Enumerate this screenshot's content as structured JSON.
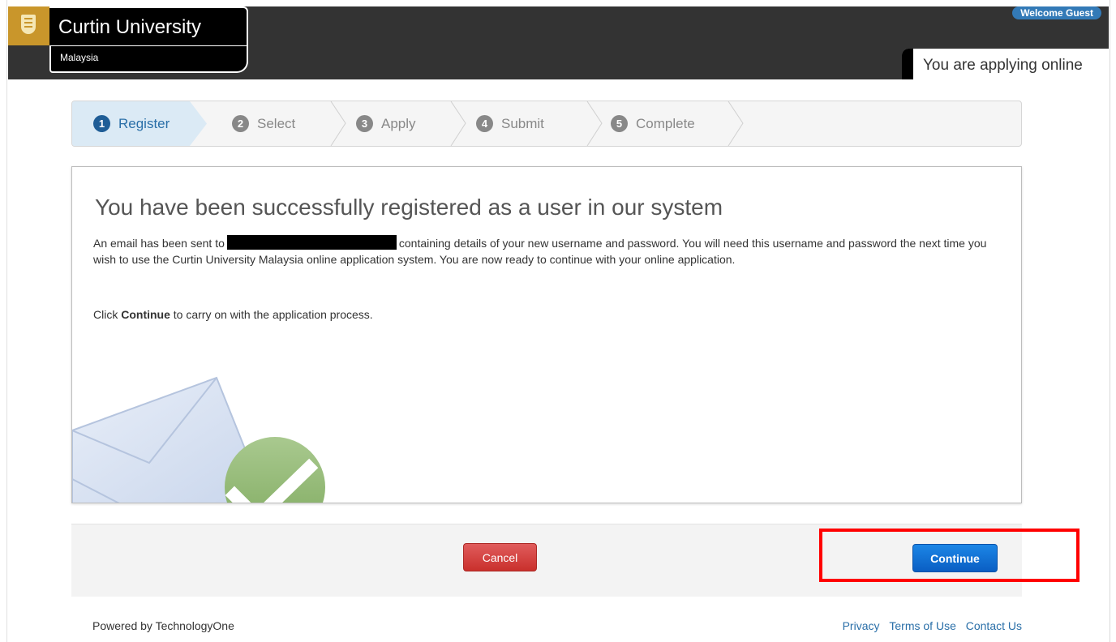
{
  "header": {
    "brand_name": "Curtin University",
    "brand_sub": "Malaysia",
    "welcome": "Welcome Guest",
    "applying": "You are applying online"
  },
  "wizard": {
    "steps": [
      {
        "num": "1",
        "label": "Register",
        "active": true
      },
      {
        "num": "2",
        "label": "Select",
        "active": false
      },
      {
        "num": "3",
        "label": "Apply",
        "active": false
      },
      {
        "num": "4",
        "label": "Submit",
        "active": false
      },
      {
        "num": "5",
        "label": "Complete",
        "active": false
      }
    ]
  },
  "content": {
    "title": "You have been successfully registered as a user in our system",
    "para1_start": "An email has been sent to",
    "para1_end": "containing details of your new username and password. You will need this username and password the next time you wish to use the Curtin University Malaysia online application system. You are now ready to continue with your online application.",
    "para2_start": "Click",
    "para2_bold": "Continue",
    "para2_end": "to carry on with the application process."
  },
  "actions": {
    "cancel": "Cancel",
    "continue": "Continue"
  },
  "footer": {
    "powered_by": "Powered by TechnologyOne",
    "links": [
      "Privacy",
      "Terms of Use",
      "Contact Us"
    ]
  },
  "colors": {
    "topbar": "#333333",
    "accent_blue": "#337ab7",
    "cancel_red": "#c9302c",
    "continue_blue": "#0a5ec3",
    "highlight_red": "#ff0000"
  }
}
